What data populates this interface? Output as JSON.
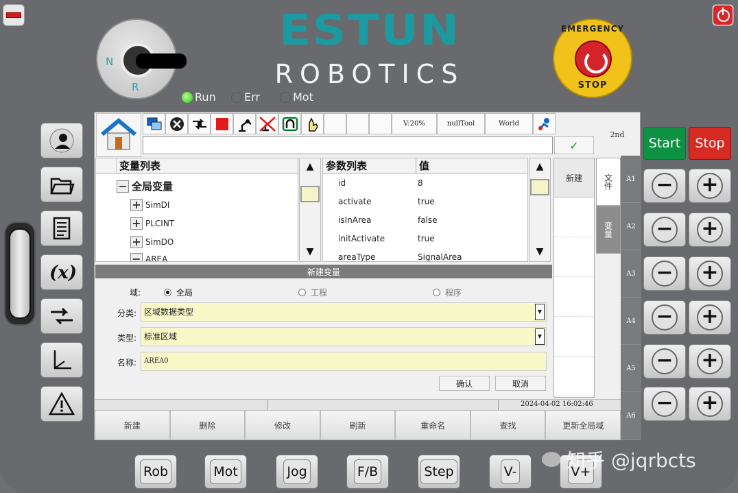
{
  "header": {
    "brand": "ESTUN",
    "brand_sub": "ROBOTICS",
    "key_labels": {
      "n": "N",
      "r": "R"
    },
    "emergency": {
      "top": "EMERGENCY",
      "bottom": "STOP"
    },
    "status": [
      {
        "label": "Run",
        "on": true
      },
      {
        "label": "Err",
        "on": false
      },
      {
        "label": "Mot",
        "on": false
      }
    ]
  },
  "right_panel": {
    "start_label": "Start",
    "stop_label": "Stop",
    "minus": "−",
    "plus": "+"
  },
  "bottom_keys": [
    "Rob",
    "Mot",
    "Jog",
    "F/B",
    "Step",
    "V-",
    "V+"
  ],
  "screen": {
    "toolbar": {
      "speed": "V:20%",
      "tool": "nullTool",
      "coord": "World",
      "second": "2nd"
    },
    "tree": {
      "header": "变量列表",
      "root": "全局变量",
      "items": [
        "SimDI",
        "PLCINT",
        "SimDO",
        "AREA"
      ],
      "collapse_sign": "−",
      "expand_sign": "+"
    },
    "params": {
      "header_key": "参数列表",
      "header_val": "值",
      "rows": [
        {
          "k": "id",
          "v": "8"
        },
        {
          "k": "activate",
          "v": "true"
        },
        {
          "k": "isInArea",
          "v": "false"
        },
        {
          "k": "initActivate",
          "v": "true"
        },
        {
          "k": "areaType",
          "v": "SignalArea"
        }
      ]
    },
    "side_new": "新建",
    "vtabs": [
      "文件",
      "变量"
    ],
    "axes": [
      "A1",
      "A2",
      "A3",
      "A4",
      "A5",
      "A6"
    ],
    "form": {
      "title": "新建变量",
      "scope_label": "域:",
      "scope_options": [
        "全局",
        "工程",
        "程序"
      ],
      "category_label": "分类:",
      "category_value": "区域数据类型",
      "type_label": "类型:",
      "type_value": "标准区域",
      "name_label": "名称:",
      "name_value": "AREA0",
      "confirm": "确认",
      "cancel": "取消"
    },
    "datetime": "2024-04-02 16:02:46",
    "bottom_buttons": [
      "新建",
      "删除",
      "修改",
      "刷新",
      "重命名",
      "查找",
      "更新全局域"
    ]
  },
  "watermark": "知乎 @jqrbcts"
}
